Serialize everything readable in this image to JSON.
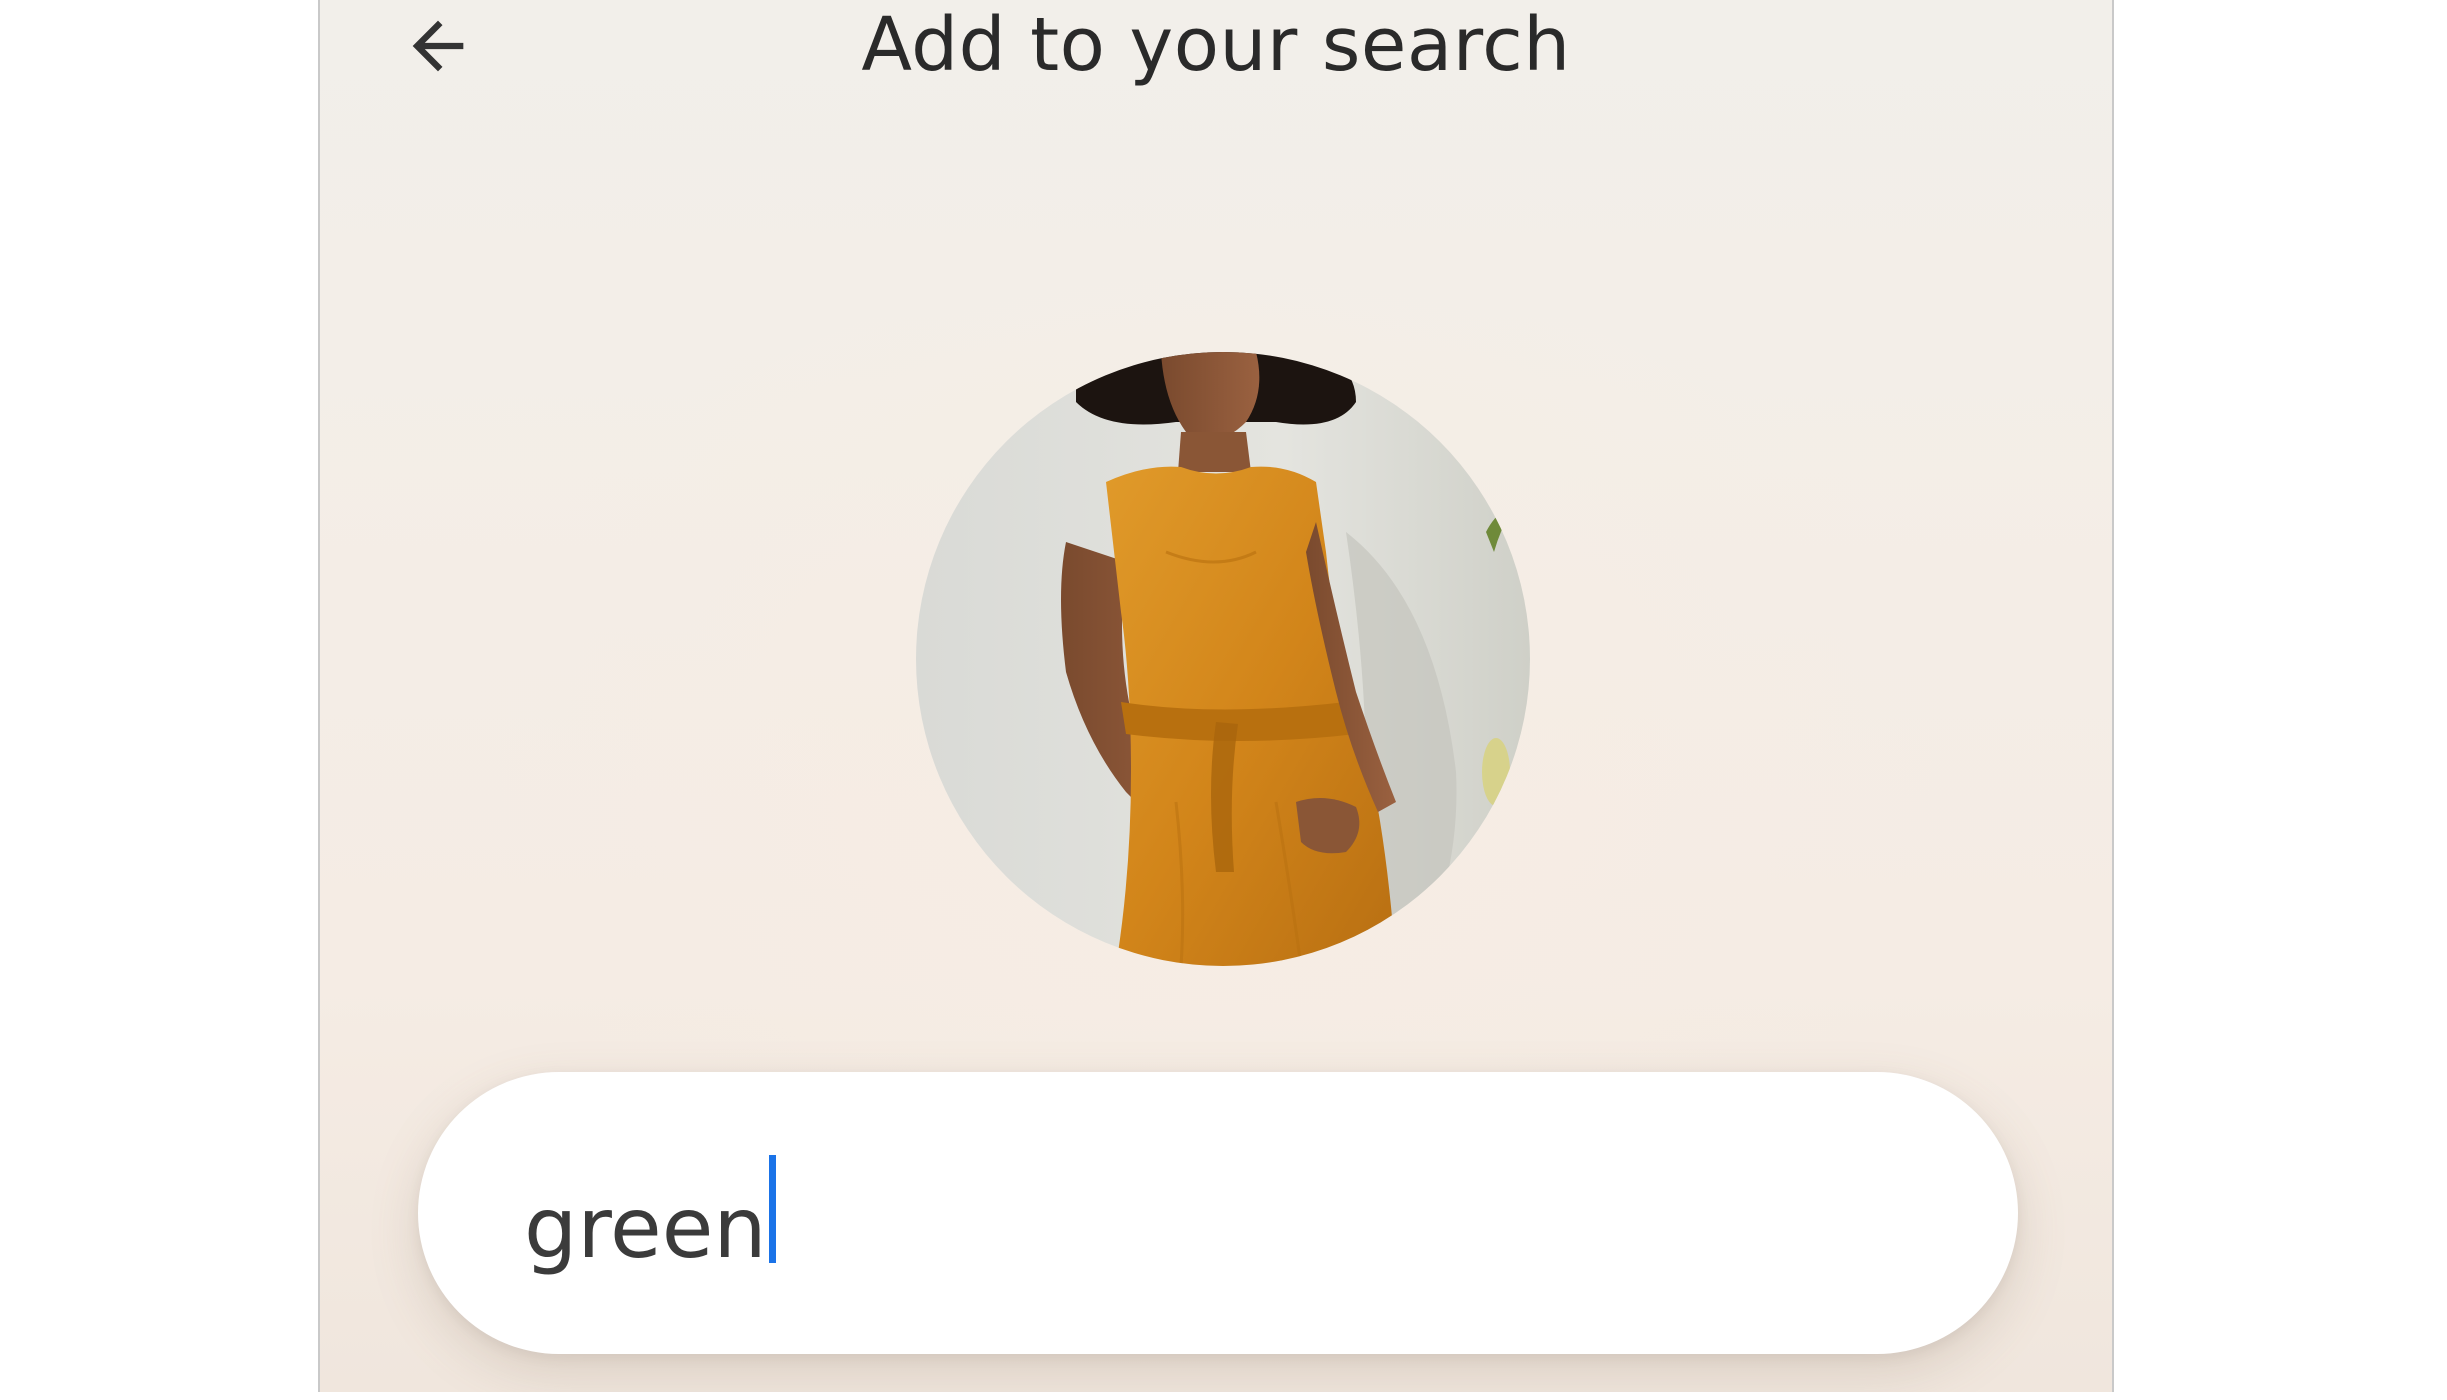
{
  "header": {
    "title": "Add to your search",
    "back_icon": "arrow-left-icon"
  },
  "image": {
    "subject": "person-in-orange-dress"
  },
  "search": {
    "value": "green",
    "caret_color": "#1a73e8"
  },
  "colors": {
    "dress": "#d68a1c",
    "text": "#2a2a2a"
  }
}
